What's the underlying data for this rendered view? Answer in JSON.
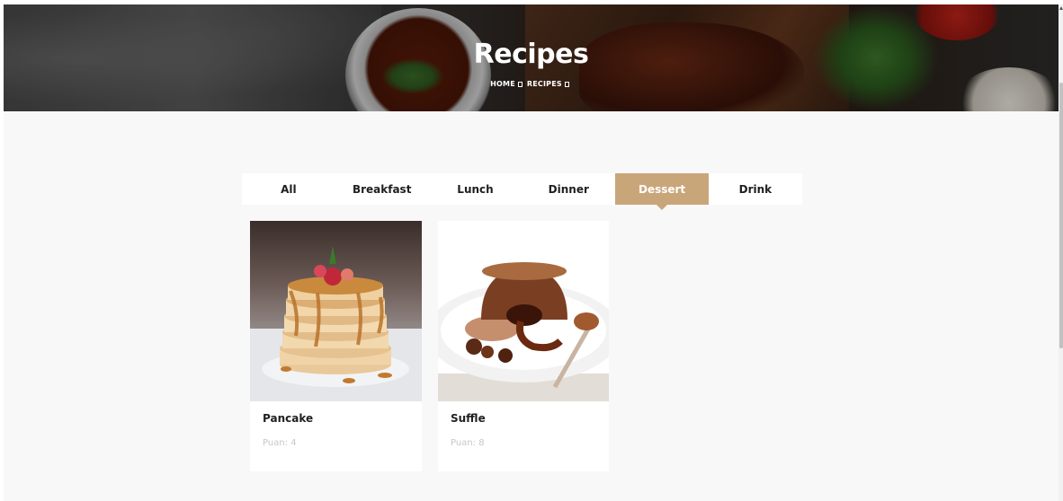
{
  "hero": {
    "title": "Recipes",
    "breadcrumb": [
      "HOME",
      "RECIPES"
    ]
  },
  "tabs": [
    {
      "label": "All",
      "active": false
    },
    {
      "label": "Breakfast",
      "active": false
    },
    {
      "label": "Lunch",
      "active": false
    },
    {
      "label": "Dinner",
      "active": false
    },
    {
      "label": "Dessert",
      "active": true
    },
    {
      "label": "Drink",
      "active": false
    }
  ],
  "recipes": [
    {
      "title": "Pancake",
      "meta": "Puan: 4",
      "image": "pancake-stack-photo"
    },
    {
      "title": "Suffle",
      "meta": "Puan: 8",
      "image": "chocolate-souffle-photo"
    }
  ],
  "colors": {
    "accent": "#c9a67a",
    "page_background": "#f8f8f8",
    "text_dark": "#1f1f1f",
    "text_muted": "#c7c7c7"
  }
}
